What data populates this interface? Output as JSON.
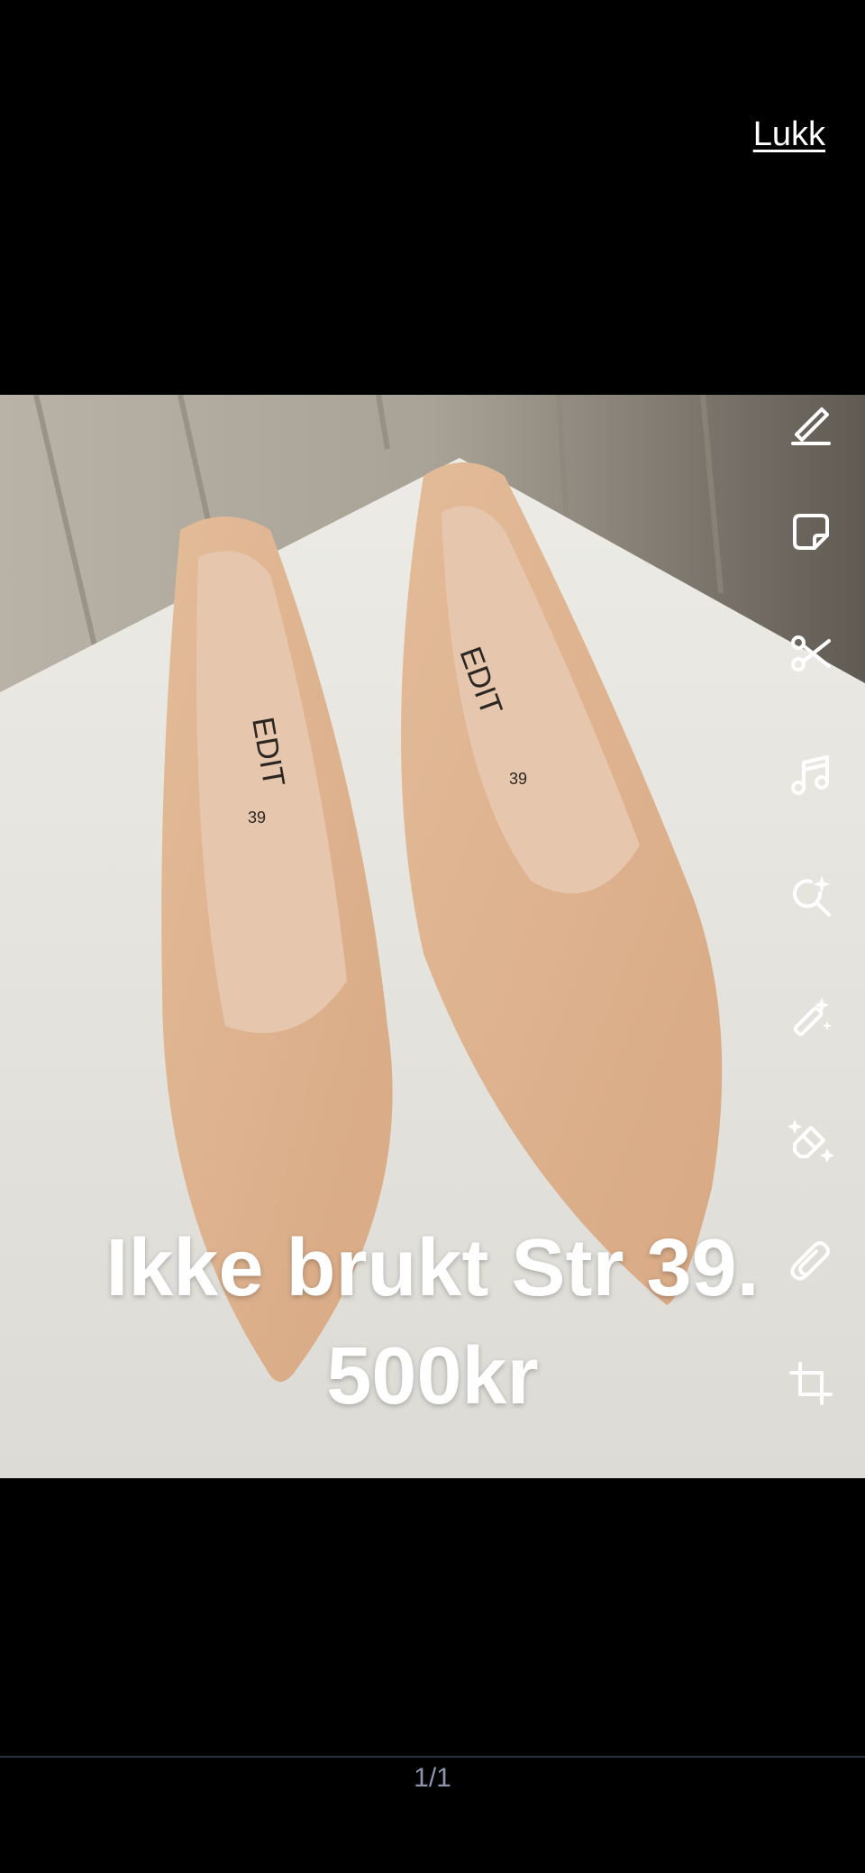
{
  "header": {
    "close_label": "Lukk"
  },
  "caption": {
    "line1": "Ikke brukt Str 39.",
    "line2": "500kr"
  },
  "photo": {
    "brand_label": "EDIT",
    "size_label": "39"
  },
  "tools": [
    {
      "name": "pen-icon"
    },
    {
      "name": "sticker-icon"
    },
    {
      "name": "scissors-icon"
    },
    {
      "name": "music-note-icon"
    },
    {
      "name": "magic-search-icon"
    },
    {
      "name": "magic-wand-icon"
    },
    {
      "name": "magic-eraser-icon"
    },
    {
      "name": "paperclip-icon"
    },
    {
      "name": "crop-icon"
    }
  ],
  "footer": {
    "page_indicator": "1/1"
  }
}
